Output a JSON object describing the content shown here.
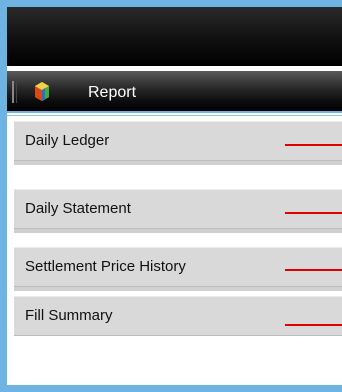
{
  "header": {
    "icon": "report-icon",
    "title": "Report"
  },
  "menu": {
    "items": [
      {
        "label": "Daily Ledger"
      },
      {
        "label": "Daily Statement"
      },
      {
        "label": "Settlement Price History"
      },
      {
        "label": "Fill Summary"
      }
    ]
  },
  "colors": {
    "frame": "#6fb3e3",
    "header_bg": "#000000",
    "menu_item_bg": "#d9d9d9",
    "indicator_line": "#e10000"
  }
}
